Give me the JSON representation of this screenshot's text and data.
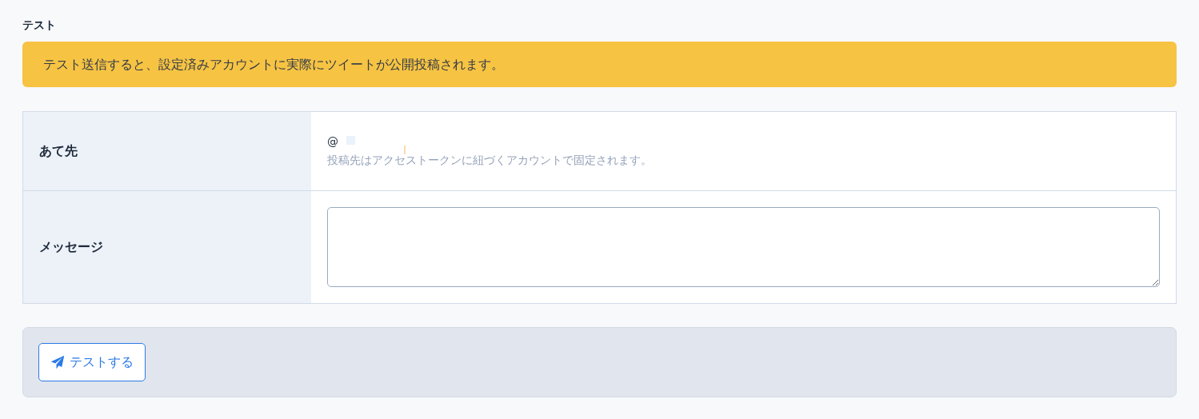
{
  "section_title": "テスト",
  "alert": {
    "text": "テスト送信すると、設定済みアカウントに実際にツイートが公開投稿されます。"
  },
  "form": {
    "rows": [
      {
        "kind": "static",
        "label": "あて先",
        "value": "@",
        "help": "投稿先はアクセストークンに紐づくアカウントで固定されます。"
      },
      {
        "kind": "textarea",
        "label": "メッセージ"
      }
    ]
  },
  "submit_button": {
    "label": "テストする"
  }
}
